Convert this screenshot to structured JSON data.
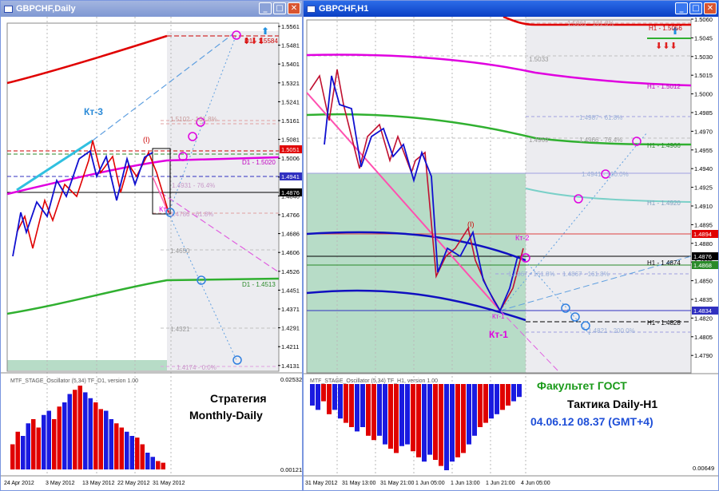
{
  "left": {
    "title": "GBPCHF,Daily",
    "price_labels": [
      "1.5561",
      "1.5481",
      "1.5401",
      "1.5321",
      "1.5241",
      "1.5161",
      "1.5081",
      "1.5006",
      "1.4926",
      "1.4846",
      "1.4766",
      "1.4686",
      "1.4606",
      "1.4526",
      "1.4451",
      "1.4371",
      "1.4291",
      "1.4211",
      "1.4131"
    ],
    "current_price": "1.5051",
    "bid_marker": "1.4941",
    "cur_marker": "1.4876",
    "date_labels": [
      "24 Apr 2012",
      "3 May 2012",
      "13 May 2012",
      "22 May 2012",
      "31 May 2012"
    ],
    "osc_labels": [
      "0.02532",
      "0.00121"
    ],
    "osc_title": "MTF_STAGE_Oscillator (5,34) TF_D1, version 1.00",
    "kt3": "Кт-3",
    "kt": "Кт",
    "wave_label": "(I)",
    "fib_labels": [
      "1.5102 - 161.8%",
      "1.4931 - 76.4%",
      "1.4786 - 61.8%",
      "1.4650",
      "1.4321",
      "1.4174 - 0.0%"
    ],
    "d1_top": "D1 - 1.5584",
    "d1_mid": "D1 - 1.5020",
    "d1_low": "D1 - 1.4513",
    "strategy": "Стратегия",
    "strategy_sub": "Monthly-Daily"
  },
  "right": {
    "title": "GBPCHF,H1",
    "price_labels": [
      "1.5060",
      "1.5045",
      "1.5030",
      "1.5015",
      "1.5000",
      "1.4985",
      "1.4970",
      "1.4955",
      "1.4940",
      "1.4925",
      "1.4910",
      "1.4895",
      "1.4880",
      "1.4865",
      "1.4850",
      "1.4835",
      "1.4820",
      "1.4805",
      "1.4790"
    ],
    "red_marker": "1.4894",
    "cur_marker": "1.4876",
    "green_marker": "1.4868",
    "blue_marker": "1.4834",
    "date_labels": [
      "31 May 2012",
      "31 May 13:00",
      "31 May 21:00",
      "1 Jun 05:00",
      "1 Jun 13:00",
      "1 Jun 21:00",
      "4 Jun 05:00"
    ],
    "osc_labels": [
      "0.00649"
    ],
    "osc_title": "MTF_STAGE_Oscillator (5,34) TF_H1, version 1.00",
    "h1_labels": [
      "H1 - 1.5056",
      "H1 - 1.5012",
      "H1 - 1.4966",
      "H1 - 1.4920",
      "H1 - 1.4874",
      "H1 - 1.4828"
    ],
    "fib_labels": [
      "1.5061 - 161.8%",
      "1.5033",
      "1.4987 - 61.8%",
      "1.4969",
      "1.4966 - 76.4%",
      "1.4941 - 100.0%",
      "1.4867 - 161.8%",
      "1.4867 - 161.8%",
      "1.4821 - 200.0%"
    ],
    "kt1": "Кт-1",
    "kt1_small": "Кт-1",
    "kt2": "Кт-2",
    "wave_label": "(I)",
    "faculty": "Факультет ГОСТ",
    "tactic": "Тактика Daily-H1",
    "timestamp": "04.06.12  08.37 (GMT+4)"
  },
  "colors": {
    "ma_red": "#e00000",
    "ma_magenta": "#e000e0",
    "ma_green": "#30b030",
    "ma_blue": "#1010c0",
    "zone_green": "#b7dcc7",
    "zone_gray": "#ececf0"
  },
  "icons": [
    "window-icon",
    "minimize-icon",
    "maximize-icon",
    "close-icon",
    "up-arrow-icon",
    "down-arrow-icon"
  ]
}
